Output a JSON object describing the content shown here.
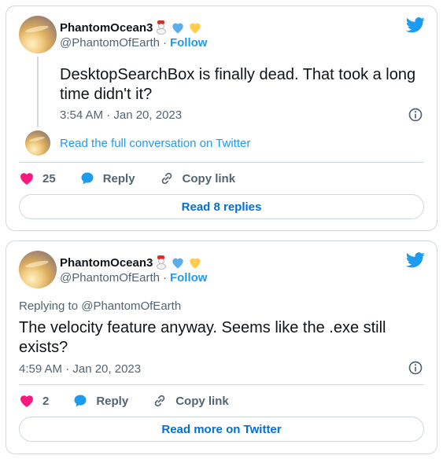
{
  "tweets": [
    {
      "author_name": "PhantomOcean3",
      "handle": "@PhantomOfEarth",
      "separator": "·",
      "follow_label": "Follow",
      "text": "DesktopSearchBox is finally dead. That took a long time didn't it?",
      "timestamp": "3:54 AM · Jan 20, 2023",
      "read_full_label": "Read the full conversation on Twitter",
      "likes": "25",
      "reply_label": "Reply",
      "copy_label": "Copy link",
      "bottom_button_label": "Read 8 replies"
    },
    {
      "author_name": "PhantomOcean3",
      "handle": "@PhantomOfEarth",
      "separator": "·",
      "follow_label": "Follow",
      "replying_to": "Replying to @PhantomOfEarth",
      "text": "The velocity feature anyway. Seems like the .exe still exists?",
      "timestamp": "4:59 AM · Jan 20, 2023",
      "likes": "2",
      "reply_label": "Reply",
      "copy_label": "Copy link",
      "bottom_button_label": "Read more on Twitter"
    }
  ],
  "colors": {
    "accent": "#1d9bf0",
    "like": "#f91880",
    "button_text": "#006fd6",
    "muted": "#536471",
    "border": "#cfd9de"
  },
  "icons": [
    "snowman-emoji",
    "blue-heart-emoji",
    "yellow-heart-emoji",
    "twitter-bird-icon",
    "info-icon",
    "heart-icon",
    "reply-bubble-icon",
    "link-icon"
  ]
}
